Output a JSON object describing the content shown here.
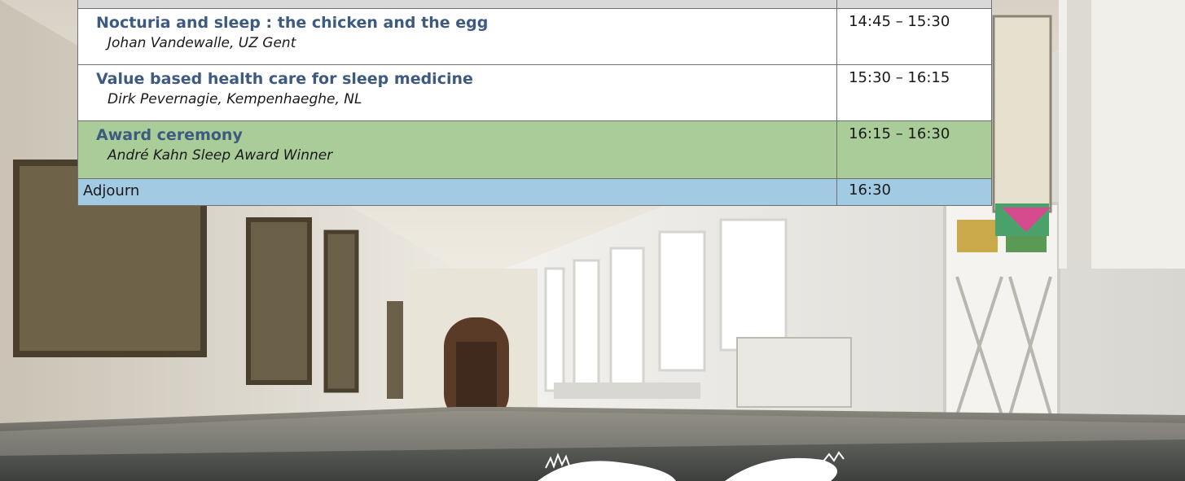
{
  "schedule": {
    "rows": [
      {
        "title": "Nocturia and sleep : the chicken and the egg",
        "speaker": "Johan Vandewalle, UZ Gent",
        "time": "14:45 – 15:30"
      },
      {
        "title": "Value based health care for sleep medicine",
        "speaker": "Dirk Pevernagie, Kempenhaeghe, NL",
        "time": "15:30 – 16:15"
      },
      {
        "title": "Award ceremony",
        "speaker": "André Kahn Sleep Award Winner",
        "time": "16:15 – 16:30"
      }
    ],
    "adjourn": {
      "label": "Adjourn",
      "time": "16:30"
    }
  },
  "colors": {
    "title_blue": "#3d5a80",
    "award_green": "#a9cc98",
    "adjourn_blue": "#a3cae3"
  }
}
